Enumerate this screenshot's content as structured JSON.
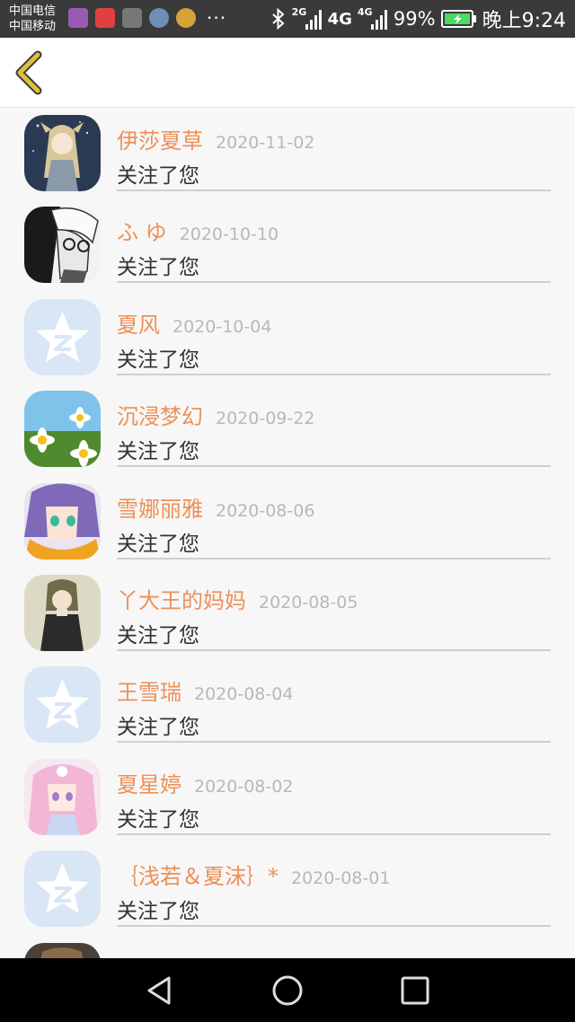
{
  "status_bar": {
    "carrier_1": "中国电信",
    "carrier_2": "中国移动",
    "more": "···",
    "network_1": "2G",
    "network_2": "4G",
    "network_3": "4G",
    "battery_percent": "99%",
    "time": "晚上9:24"
  },
  "header": {
    "back_icon": "chevron-left-icon",
    "accent_color": "#e0c03a"
  },
  "colors": {
    "name": "#ef8f57",
    "date": "#b8b8b8",
    "divider": "#cfcfcf"
  },
  "followers": [
    {
      "name": "伊莎夏草",
      "date": "2020-11-02",
      "action": "关注了您",
      "avatar": "anime-girl-dark"
    },
    {
      "name": "ふ ゆ",
      "date": "2020-10-10",
      "action": "关注了您",
      "avatar": "manga-boy-bw"
    },
    {
      "name": "夏风",
      "date": "2020-10-04",
      "action": "关注了您",
      "avatar": "default-qzone-star"
    },
    {
      "name": "沉浸梦幻",
      "date": "2020-09-22",
      "action": "关注了您",
      "avatar": "daisy-flowers"
    },
    {
      "name": "雪娜丽雅",
      "date": "2020-08-06",
      "action": "关注了您",
      "avatar": "anime-girl-purple"
    },
    {
      "name": "丫大王的妈妈",
      "date": "2020-08-05",
      "action": "关注了您",
      "avatar": "anime-girl-black-dress"
    },
    {
      "name": "王雪瑞",
      "date": "2020-08-04",
      "action": "关注了您",
      "avatar": "default-qzone-star"
    },
    {
      "name": "夏星婷",
      "date": "2020-08-02",
      "action": "关注了您",
      "avatar": "anime-girl-pink"
    },
    {
      "name": "｛浅若＆夏沫｝*",
      "date": "2020-08-01",
      "action": "关注了您",
      "avatar": "default-qzone-star"
    },
    {
      "name": "",
      "date": "",
      "action": "",
      "avatar": "partial-cutoff"
    }
  ],
  "nav_bar": {
    "back": "triangle-back-icon",
    "home": "circle-home-icon",
    "recents": "square-recents-icon"
  }
}
